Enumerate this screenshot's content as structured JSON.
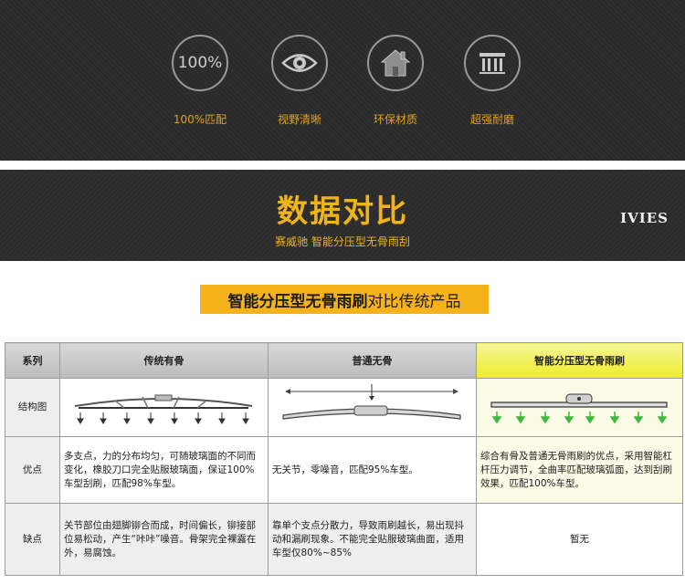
{
  "features": [
    {
      "icon": "percent-100-icon",
      "icon_text": "100%",
      "caption": "100%匹配"
    },
    {
      "icon": "eye-icon",
      "caption": "视野清晰"
    },
    {
      "icon": "house-icon",
      "caption": "环保材质"
    },
    {
      "icon": "wear-resistant-icon",
      "caption": "超强耐磨"
    }
  ],
  "title": {
    "main": "数据对比",
    "sub": "赛威驰 智能分压型无骨雨刮",
    "brand": "IVIES"
  },
  "banner": {
    "bold": "智能分压型无骨雨刷",
    "light": "对比传统产品"
  },
  "table": {
    "headers": [
      "系列",
      "传统有骨",
      "普通无骨",
      "智能分压型无骨雨刷"
    ],
    "rows": {
      "structure_label": "结构图",
      "pros_label": "优点",
      "cons_label": "缺点",
      "pros": [
        "多支点，力的分布均匀，可随玻璃面的不同而变化，橡胶刀口完全贴服玻璃面，保证100%车型刮刷，匹配98%车型。",
        "无关节，零噪音，匹配95%车型。",
        "综合有骨及普通无骨雨刷的优点，采用智能杠杆压力调节，全曲率匹配玻璃弧面，达到刮刷效果，匹配100%车型。"
      ],
      "cons": [
        "关节部位由翅脚铆合而成，时间偏长，铆接部位易松动，产生“咔咔”噪音。骨架完全裸露在外，易腐蚀。",
        "靠单个支点分散力，导致雨刷越长，易出现抖动和漏刷现象。不能完全贴服玻璃曲面，适用车型仅80%~85%",
        "暂无"
      ]
    }
  },
  "colors": {
    "accent": "#f0b31a",
    "banner": "#f6b21b",
    "highlight_header": "#eded2a",
    "arrow_green": "#3fb83f"
  }
}
